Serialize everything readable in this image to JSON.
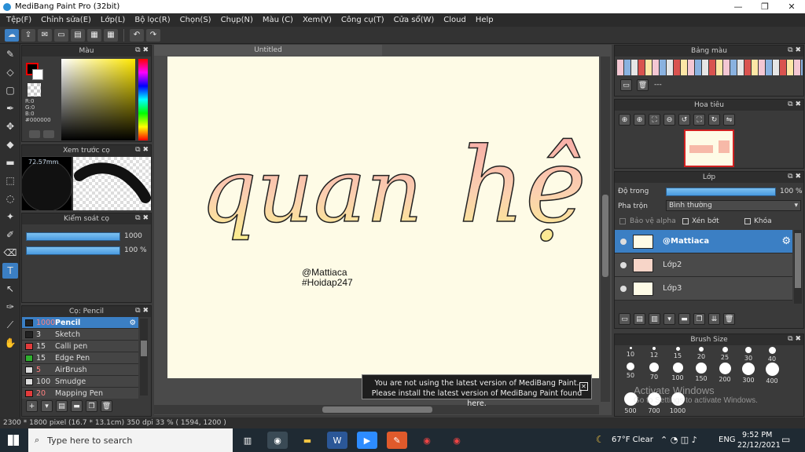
{
  "window": {
    "title": "MediBang Paint Pro (32bit)"
  },
  "menu": [
    "Tệp(F)",
    "Chỉnh sửa(E)",
    "Lớp(L)",
    "Bộ lọc(R)",
    "Chọn(S)",
    "Chụp(N)",
    "Màu (C)",
    "Xem(V)",
    "Công cụ(T)",
    "Cửa sổ(W)",
    "Cloud",
    "Help"
  ],
  "panels": {
    "color": {
      "title": "Màu",
      "r": "R:0",
      "g": "G:0",
      "b": "B:0",
      "hex": "#000000"
    },
    "preview": {
      "title": "Xem trước cọ",
      "size": "72.57mm"
    },
    "control": {
      "title": "Kiểm soát cọ",
      "size": "1000",
      "opacity": "100 %"
    },
    "brush": {
      "title": "Cọ: Pencil",
      "items": [
        {
          "size": "1000",
          "name": "Pencil",
          "color": "#222222"
        },
        {
          "size": "3",
          "name": "Sketch",
          "color": "#222222"
        },
        {
          "size": "15",
          "name": "Calli pen",
          "color": "#e23b3b"
        },
        {
          "size": "15",
          "name": "Edge Pen",
          "color": "#2fb02f"
        },
        {
          "size": "5",
          "name": "AirBrush",
          "color": "#dddddd"
        },
        {
          "size": "100",
          "name": "Smudge",
          "color": "#dddddd"
        },
        {
          "size": "20",
          "name": "Mapping Pen",
          "color": "#e23b3b"
        }
      ]
    },
    "palette": {
      "title": "Bảng màu",
      "label": "---"
    },
    "navigator": {
      "title": "Hoa tiêu"
    },
    "layer": {
      "title": "Lớp",
      "opacity_label": "Độ trong",
      "opacity_value": "100 %",
      "blend_label": "Pha trộn",
      "blend_value": "Bình thường",
      "alpha": "Bảo vệ alpha",
      "clip": "Xén bớt",
      "lock": "Khóa",
      "layers": [
        {
          "name": "@Mattiaca"
        },
        {
          "name": "Lớp2"
        },
        {
          "name": "Lớp3"
        }
      ]
    },
    "brushsize": {
      "title": "Brush Size",
      "sizes": [
        "10",
        "12",
        "15",
        "20",
        "25",
        "30",
        "40",
        "50",
        "70",
        "100",
        "150",
        "200",
        "300",
        "400",
        "500",
        "700",
        "1000"
      ]
    }
  },
  "canvas": {
    "tab": "Untitled",
    "art_text_1": "quan",
    "art_text_2": "hệ",
    "credit_1": "@Mattiaca",
    "credit_2": "#Hoidap247"
  },
  "notice": {
    "line1": "You are not using the latest version of MediBang Paint.",
    "line2": "Please install the latest version of MediBang Paint found here."
  },
  "watermark": {
    "line1": "Activate Windows",
    "line2": "Go to Settings to activate Windows."
  },
  "status": {
    "text": "2300 * 1800 pixel  (16.7 * 13.1cm)  350 dpi  33 %  ( 1594, 1200 )"
  },
  "taskbar": {
    "search": "Type here to search",
    "weather": "67°F  Clear",
    "lang": "ENG",
    "time": "9:52 PM",
    "date": "22/12/2021"
  }
}
